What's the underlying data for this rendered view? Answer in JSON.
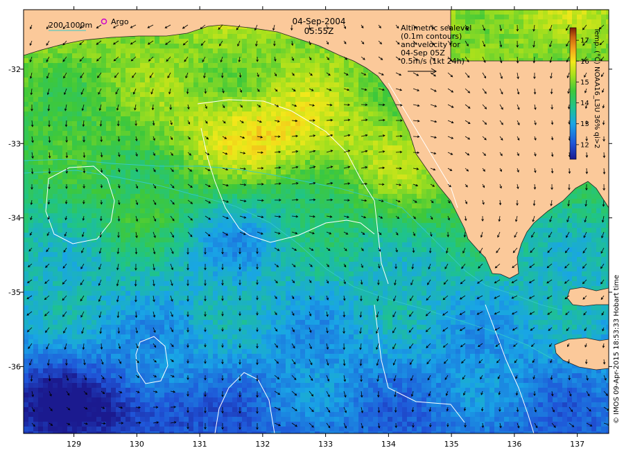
{
  "title": {
    "date": "04-Sep-2004",
    "time": "05:55Z"
  },
  "legend": {
    "isobath_label": "200  1000m",
    "argo_label": "Argo",
    "argo_color": "#cc00cc",
    "isobath_color": "#35c9c9"
  },
  "altimetry_note": [
    "Altimetric sealevel",
    "(0.1m contours)",
    "and velocity for",
    "04-Sep 05Z",
    "0.5m/s (1kt 24h)"
  ],
  "colorbar": {
    "title": "Temp. (°C) NOAA16_L3U 36% qi>2",
    "ticks": [
      "12",
      "13",
      "14",
      "15",
      "16",
      "17"
    ],
    "min": 11.3,
    "max": 17.6
  },
  "credit": "© IMOS 09-Apr-2015 18:53:33 Hobart time",
  "axes": {
    "x_ticks": [
      "129",
      "130",
      "131",
      "132",
      "133",
      "134",
      "135",
      "136",
      "137"
    ],
    "y_ticks": [
      "-32",
      "-33",
      "-34",
      "-35",
      "-36"
    ],
    "lon_range": [
      128.2,
      137.5
    ],
    "lat_range": [
      -36.9,
      -31.2
    ]
  },
  "colors": {
    "land": "#fbc99a",
    "contour": "#ffffff",
    "arrow": "#000000"
  }
}
